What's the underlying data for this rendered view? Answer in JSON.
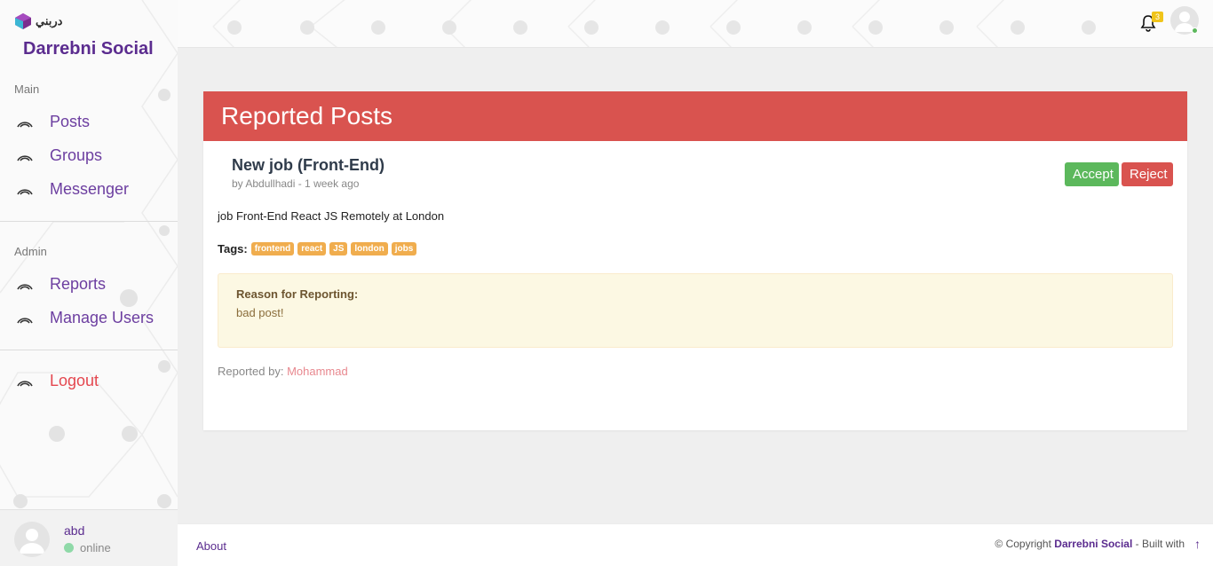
{
  "app": {
    "logo_text": "دربني",
    "brand": "Darrebni Social"
  },
  "sidebar": {
    "main_label": "Main",
    "main_items": [
      {
        "label": "Posts",
        "icon": "rss-icon"
      },
      {
        "label": "Groups",
        "icon": "rss-icon"
      },
      {
        "label": "Messenger",
        "icon": "rss-icon"
      }
    ],
    "admin_label": "Admin",
    "admin_items": [
      {
        "label": "Reports",
        "icon": "rss-icon"
      },
      {
        "label": "Manage Users",
        "icon": "rss-icon"
      }
    ],
    "logout": {
      "label": "Logout",
      "icon": "rss-icon"
    },
    "user": {
      "name": "abd",
      "status": "online"
    }
  },
  "topbar": {
    "notification_count": "3",
    "bell_icon": "bell-icon"
  },
  "page": {
    "title": "Reported Posts"
  },
  "post": {
    "title": "New job (Front-End)",
    "meta": "by Abdullhadi - 1 week ago",
    "body": "job Front-End React JS Remotely at London",
    "tags_label": "Tags:",
    "tags": [
      "frontend",
      "react",
      "JS",
      "london",
      "jobs"
    ],
    "accept_label": "Accept",
    "reject_label": "Reject",
    "reason_title": "Reason for Reporting:",
    "reason_body": "bad post!",
    "reported_by_label": "Reported by:",
    "reporter": "Mohammad"
  },
  "footer": {
    "about": "About",
    "copyright_prefix": "© Copyright ",
    "copyright_brand": "Darrebni Social",
    "copyright_suffix": " - Built with",
    "up_icon": "arrow-up-icon"
  },
  "colors": {
    "accent": "#5b2c8f",
    "danger": "#d9534f",
    "success": "#5cb85c",
    "warning": "#f0ad4e"
  }
}
